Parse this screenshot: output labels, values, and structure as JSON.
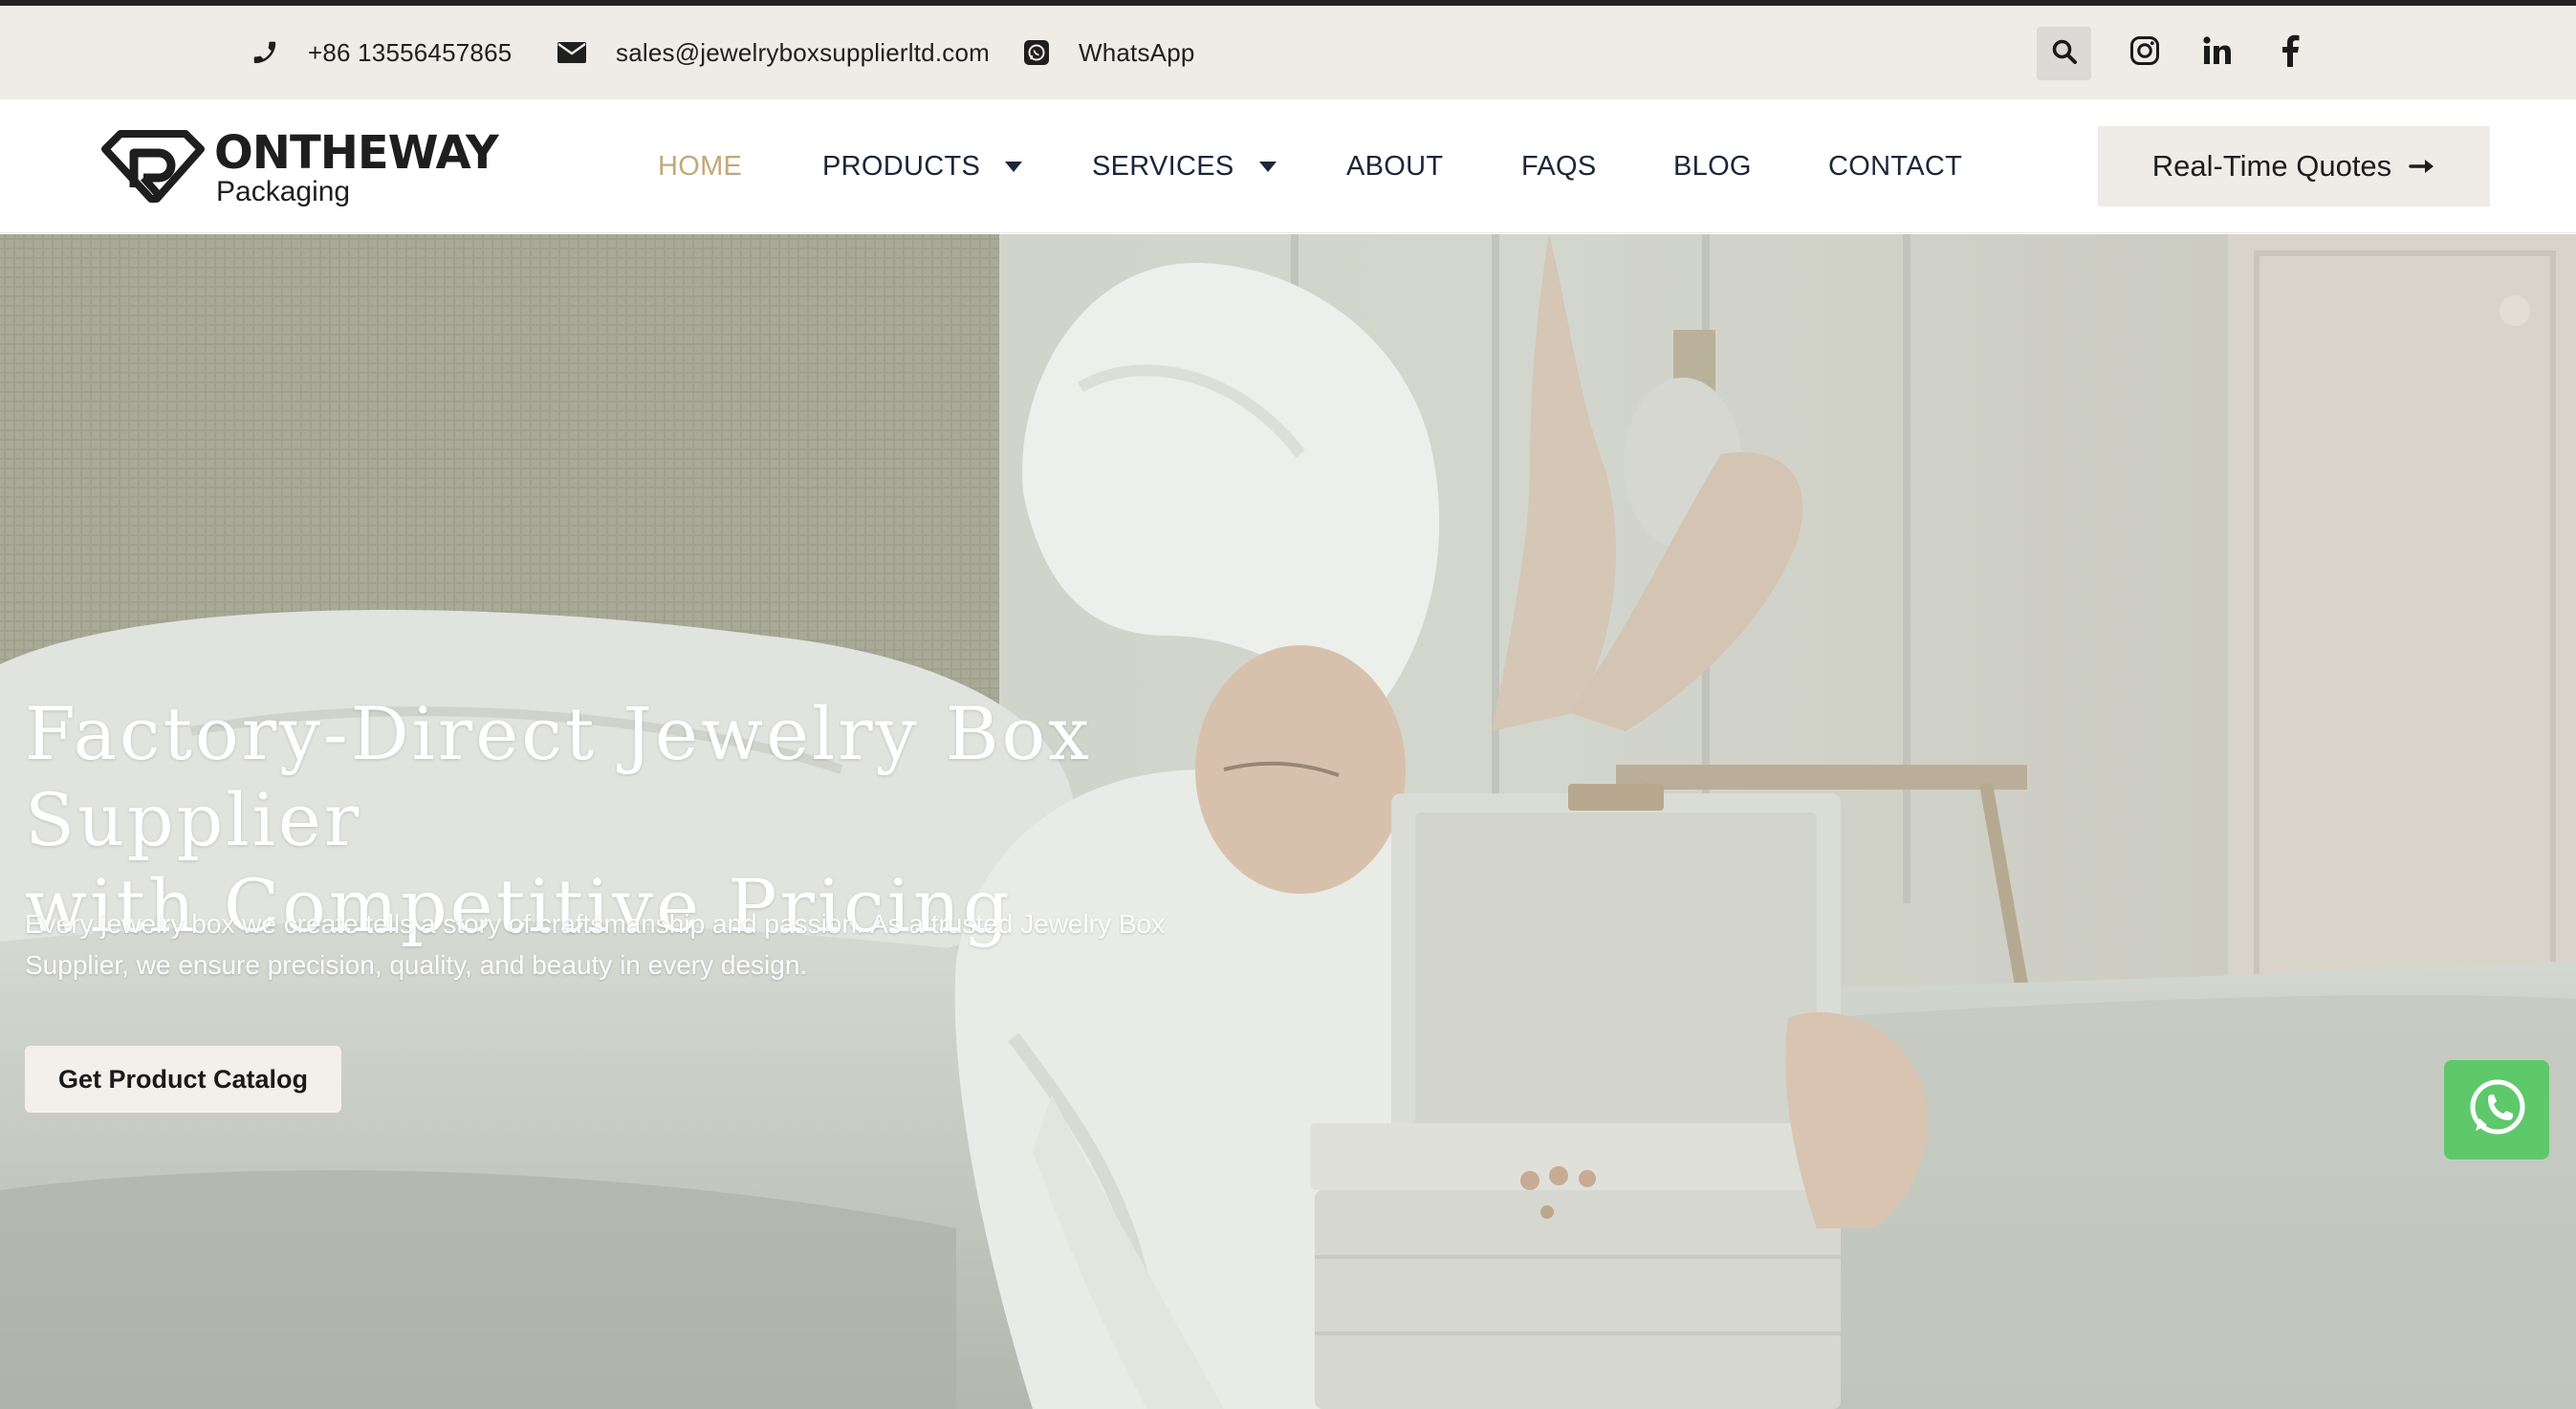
{
  "topbar": {
    "phone": "+86 13556457865",
    "email": "sales@jewelryboxsupplierltd.com",
    "whatsapp_label": "WhatsApp",
    "icons": [
      "phone-icon",
      "envelope-icon",
      "whatsapp-icon",
      "search-icon",
      "instagram-icon",
      "linkedin-icon",
      "facebook-icon"
    ]
  },
  "logo": {
    "name": "ONTHEWAY",
    "subtitle": "Packaging"
  },
  "nav": {
    "items": [
      {
        "label": "HOME",
        "active": true
      },
      {
        "label": "PRODUCTS",
        "dropdown": true
      },
      {
        "label": "SERVICES",
        "dropdown": true
      },
      {
        "label": "ABOUT"
      },
      {
        "label": "FAQS"
      },
      {
        "label": "BLOG"
      },
      {
        "label": "CONTACT"
      }
    ],
    "cta_label": "Real-Time Quotes"
  },
  "hero": {
    "title_line1": "Factory-Direct Jewelry Box Supplier",
    "title_line2": "with Competitive Pricing",
    "subtitle_line1": "Every jewelry box we create tells a story of craftsmanship and passion. As a trusted Jewelry Box",
    "subtitle_line2": "Supplier, we ensure precision, quality, and beauty in every design.",
    "cta_label": "Get Product Catalog"
  },
  "colors": {
    "topbar_bg": "#efebe6",
    "nav_active": "#c3a87a",
    "nav_text": "#1d2538",
    "whatsapp_green": "#5dc96a"
  }
}
